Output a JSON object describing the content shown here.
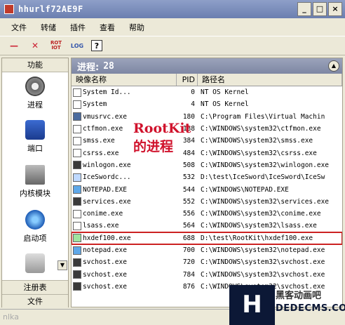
{
  "window": {
    "title": "hhurlf72AE9F",
    "min": "_",
    "max": "□",
    "close": "×"
  },
  "menu": [
    "文件",
    "转储",
    "插件",
    "查看",
    "帮助"
  ],
  "toolbar": {
    "rot_top": "ROT",
    "rot_bottom": "IOT",
    "log": "LOG",
    "help": "?"
  },
  "sidebar": {
    "header": "功能",
    "items": [
      {
        "label": "进程",
        "icon": "gear-icon"
      },
      {
        "label": "端口",
        "icon": "port-icon"
      },
      {
        "label": "内核模块",
        "icon": "driver-icon"
      },
      {
        "label": "启动项",
        "icon": "startup-icon"
      }
    ],
    "tabs": [
      "注册表",
      "文件"
    ]
  },
  "main": {
    "title": "进程:",
    "count": "28",
    "columns": {
      "name": "映像名称",
      "pid": "PID",
      "path": "路径名"
    },
    "rows": [
      {
        "name": "System Id...",
        "pid": "0",
        "path": "NT OS Kernel",
        "icon": "app"
      },
      {
        "name": "System",
        "pid": "4",
        "path": "NT OS Kernel",
        "icon": "app"
      },
      {
        "name": "vmusrvc.exe",
        "pid": "180",
        "path": "C:\\Program Files\\Virtual Machin",
        "icon": "sys"
      },
      {
        "name": "ctfmon.exe",
        "pid": "188",
        "path": "C:\\WINDOWS\\system32\\ctfmon.exe",
        "icon": "app"
      },
      {
        "name": "smss.exe",
        "pid": "384",
        "path": "C:\\WINDOWS\\system32\\smss.exe",
        "icon": "app"
      },
      {
        "name": "csrss.exe",
        "pid": "484",
        "path": "C:\\WINDOWS\\system32\\csrss.exe",
        "icon": "app"
      },
      {
        "name": "winlogon.exe",
        "pid": "508",
        "path": "C:\\WINDOWS\\system32\\winlogon.exe",
        "icon": "shield"
      },
      {
        "name": "IceSwordc...",
        "pid": "532",
        "path": "D:\\test\\IceSword\\IceSword\\IceSw",
        "icon": "ice"
      },
      {
        "name": "NOTEPAD.EXE",
        "pid": "544",
        "path": "C:\\WINDOWS\\NOTEPAD.EXE",
        "icon": "note"
      },
      {
        "name": "services.exe",
        "pid": "552",
        "path": "C:\\WINDOWS\\system32\\services.exe",
        "icon": "shield"
      },
      {
        "name": "conime.exe",
        "pid": "556",
        "path": "C:\\WINDOWS\\system32\\conime.exe",
        "icon": "app"
      },
      {
        "name": "lsass.exe",
        "pid": "564",
        "path": "C:\\WINDOWS\\system32\\lsass.exe",
        "icon": "app"
      },
      {
        "name": "hxdef100.exe",
        "pid": "688",
        "path": "D:\\test\\RootKit\\hxdef100.exe",
        "icon": "rk"
      },
      {
        "name": "notepad.exe",
        "pid": "700",
        "path": "C:\\WINDOWS\\system32\\notepad.exe",
        "icon": "note"
      },
      {
        "name": "svchost.exe",
        "pid": "720",
        "path": "C:\\WINDOWS\\system32\\svchost.exe",
        "icon": "shield"
      },
      {
        "name": "svchost.exe",
        "pid": "784",
        "path": "C:\\WINDOWS\\system32\\svchost.exe",
        "icon": "shield"
      },
      {
        "name": "svchost.exe",
        "pid": "876",
        "path": "C:\\WINDOWS\\system32\\svchost.exe",
        "icon": "shield"
      }
    ]
  },
  "annotation": {
    "line1": "RootKit",
    "line2": "的进程"
  },
  "status": "nlka",
  "watermark": {
    "logo": "H",
    "line1": "黑客动画吧",
    "line2": "DEDECMS.COM"
  }
}
